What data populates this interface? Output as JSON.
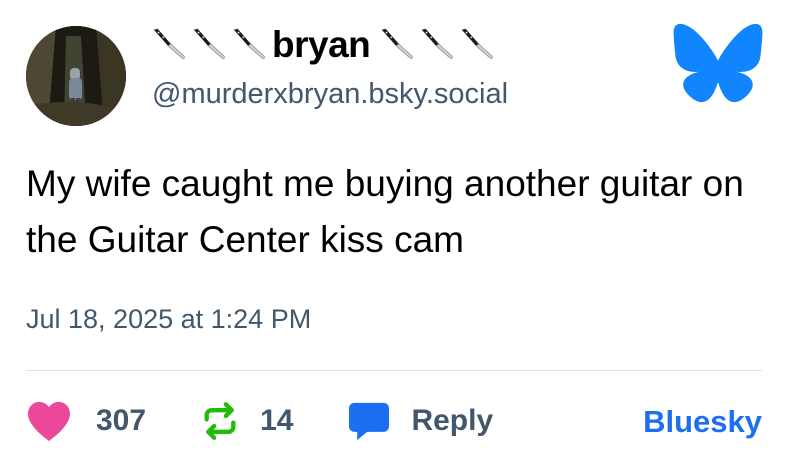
{
  "post": {
    "author": {
      "display_name": "bryan",
      "handle": "@murderxbryan.bsky.social",
      "name_decoration_icon": "kitchen-knife-icon",
      "knives_before": 3,
      "knives_after": 3
    },
    "text": "My wife caught me buying another guitar on the Guitar Center kiss cam",
    "timestamp": "Jul 18, 2025 at 1:24 PM"
  },
  "actions": {
    "likes": {
      "icon": "heart-icon",
      "count": "307",
      "color": "#ec4899"
    },
    "reposts": {
      "icon": "repost-icon",
      "count": "14",
      "color": "#20bc07"
    },
    "reply": {
      "icon": "reply-bubble-icon",
      "label": "Reply",
      "color": "#1d6ff2"
    },
    "open_in": {
      "label": "Bluesky"
    }
  },
  "branding": {
    "logo_icon": "bluesky-butterfly-icon",
    "color": "#1185fe"
  },
  "colors": {
    "text": "#000000",
    "muted": "#42576c",
    "link": "#1d6ff2",
    "divider": "#dde3ea"
  }
}
